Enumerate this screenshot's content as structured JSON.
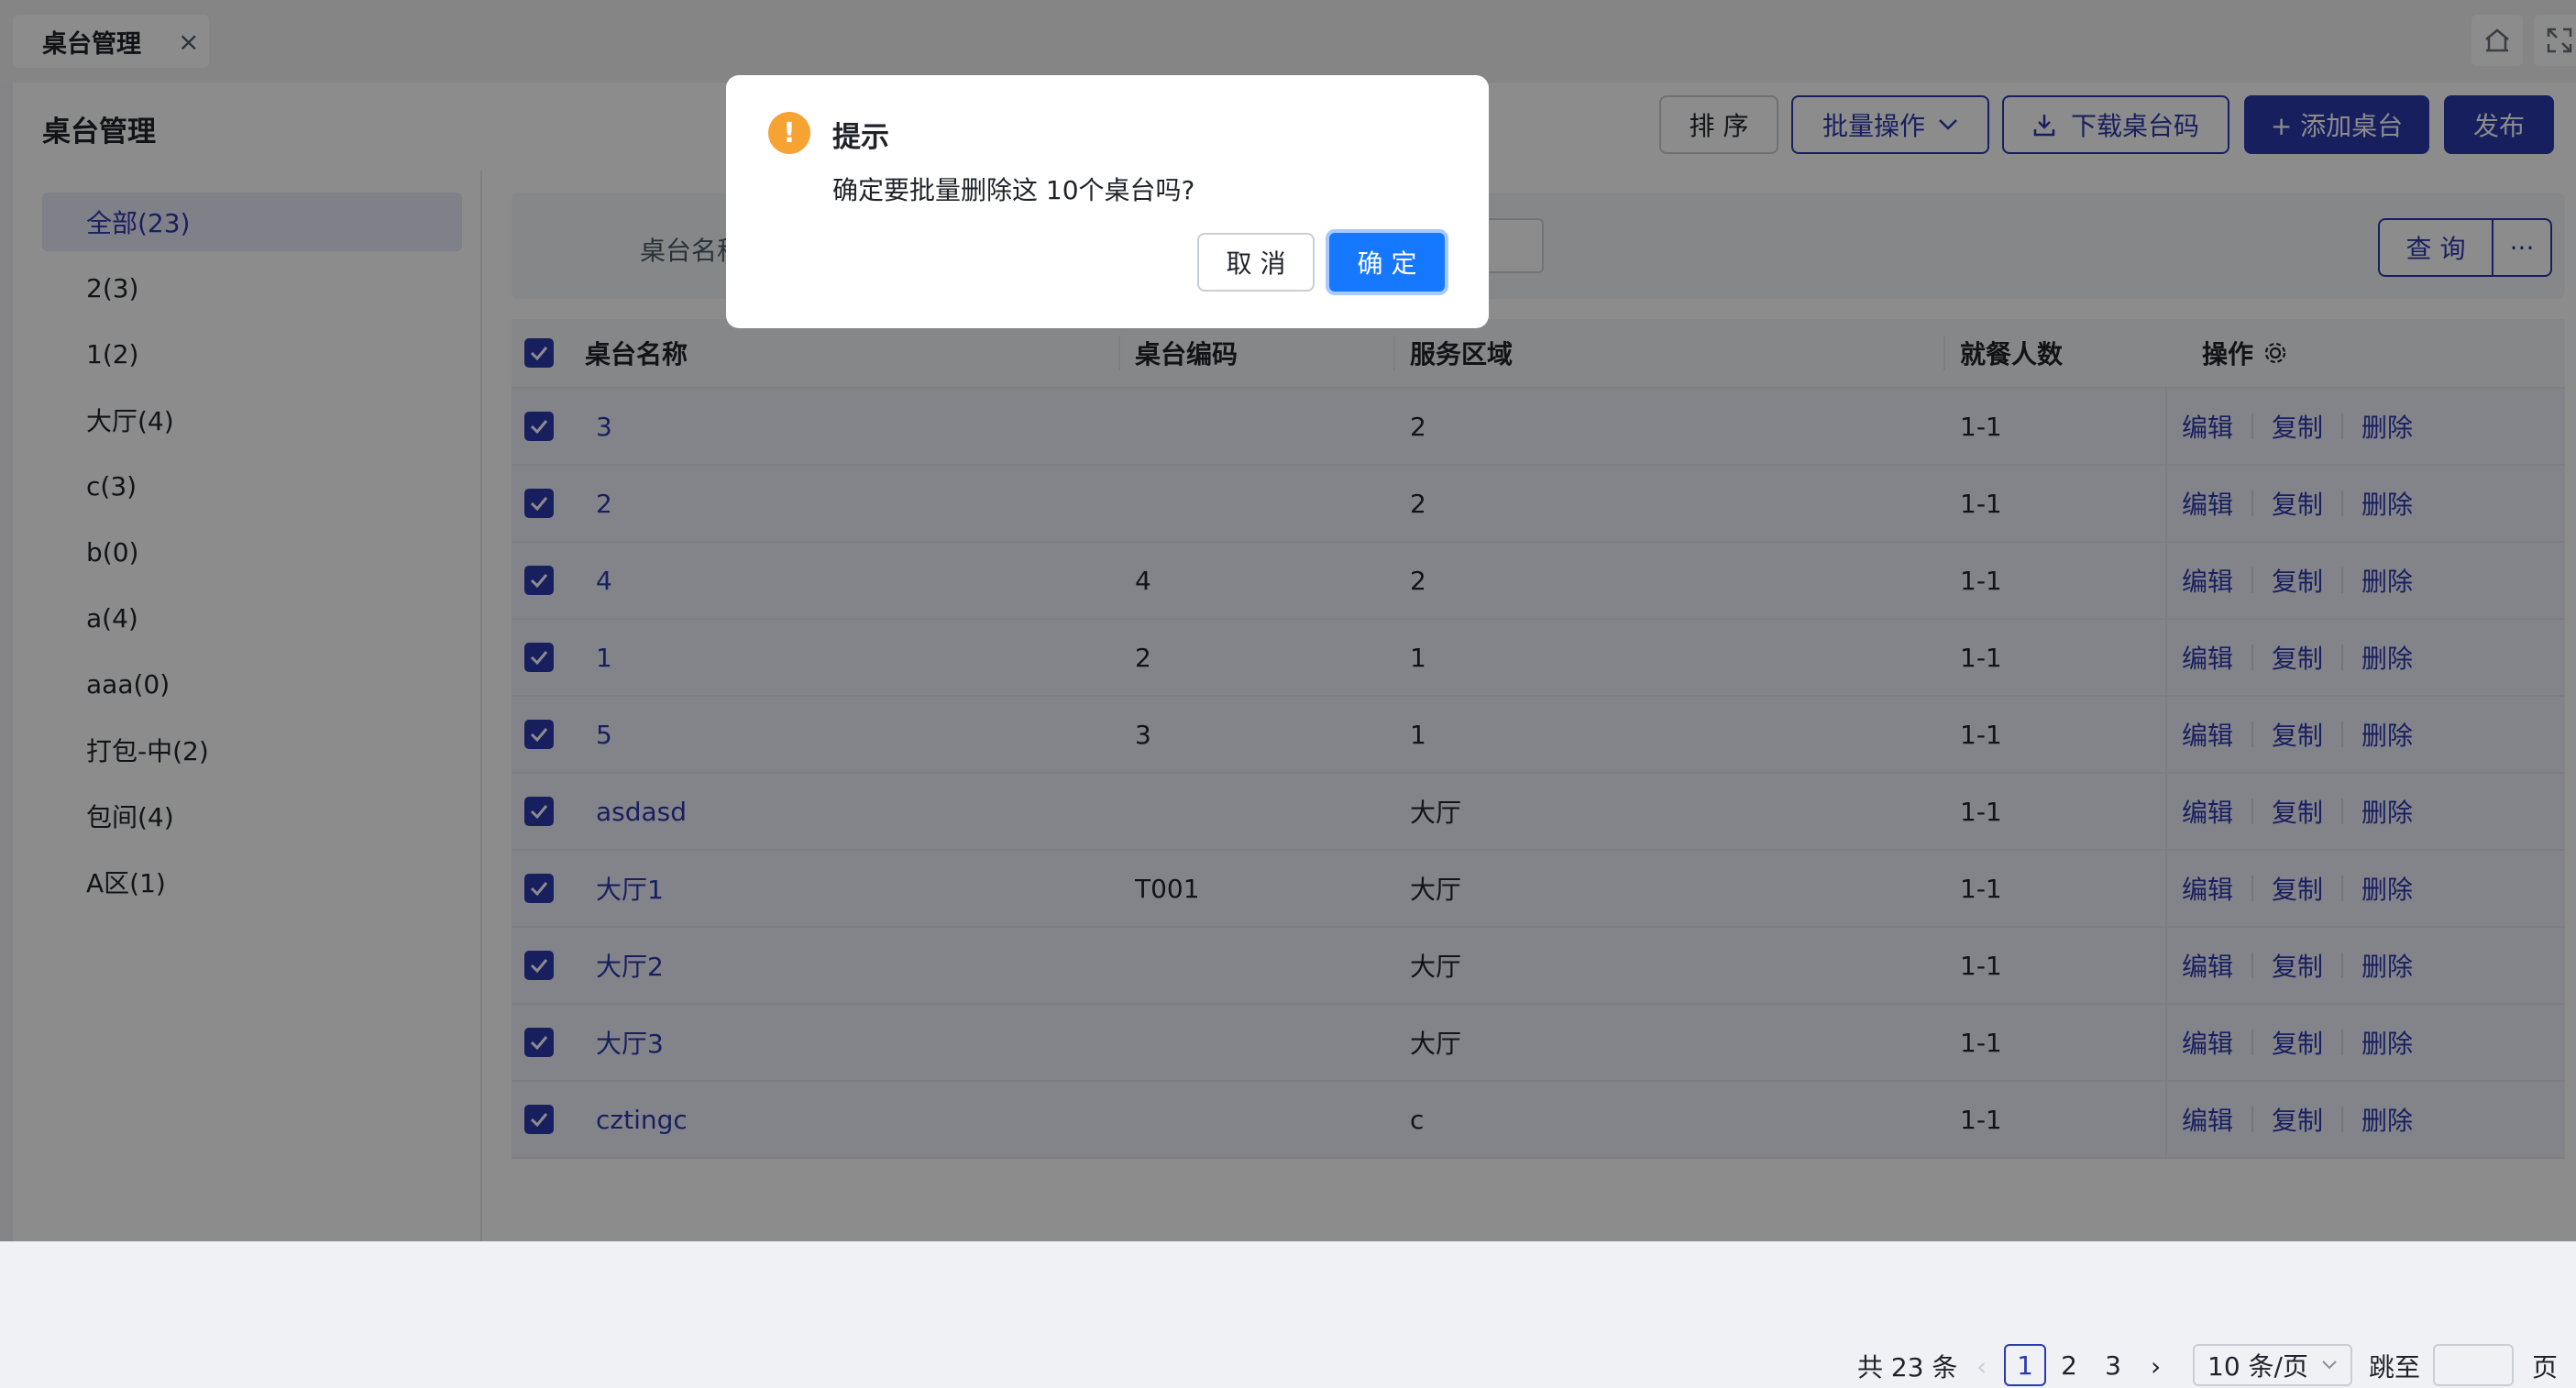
{
  "tabbar": {
    "tab_label": "桌台管理",
    "close_glyph": "×"
  },
  "header": {
    "title": "桌台管理",
    "sort_label": "排 序",
    "batch_label": "批量操作",
    "download_label": "下载桌台码",
    "add_label": "+ 添加桌台",
    "publish_label": "发布"
  },
  "sidebar": {
    "items": [
      {
        "label": "全部(23)",
        "active": true
      },
      {
        "label": "2(3)"
      },
      {
        "label": "1(2)"
      },
      {
        "label": "大厅(4)"
      },
      {
        "label": "c(3)"
      },
      {
        "label": "b(0)"
      },
      {
        "label": "a(4)"
      },
      {
        "label": "aaa(0)"
      },
      {
        "label": "打包-中(2)"
      },
      {
        "label": "包间(4)"
      },
      {
        "label": "A区(1)"
      }
    ]
  },
  "filter": {
    "label": "桌台名称",
    "query_label": "查 询",
    "more_label": "···"
  },
  "table": {
    "headers": {
      "name": "桌台名称",
      "code": "桌台编码",
      "area": "服务区域",
      "diners": "就餐人数",
      "ops": "操作"
    },
    "op_labels": {
      "edit": "编辑",
      "copy": "复制",
      "delete": "删除"
    },
    "rows": [
      {
        "name": "3",
        "code": "",
        "area": "2",
        "diners": "1-1"
      },
      {
        "name": "2",
        "code": "",
        "area": "2",
        "diners": "1-1"
      },
      {
        "name": "4",
        "code": "4",
        "area": "2",
        "diners": "1-1"
      },
      {
        "name": "1",
        "code": "2",
        "area": "1",
        "diners": "1-1"
      },
      {
        "name": "5",
        "code": "3",
        "area": "1",
        "diners": "1-1"
      },
      {
        "name": "asdasd",
        "code": "",
        "area": "大厅",
        "diners": "1-1"
      },
      {
        "name": "大厅1",
        "code": "T001",
        "area": "大厅",
        "diners": "1-1"
      },
      {
        "name": "大厅2",
        "code": "",
        "area": "大厅",
        "diners": "1-1"
      },
      {
        "name": "大厅3",
        "code": "",
        "area": "大厅",
        "diners": "1-1"
      },
      {
        "name": "cztingc",
        "code": "",
        "area": "c",
        "diners": "1-1"
      }
    ]
  },
  "pagination": {
    "total_label": "共 23 条",
    "pages": [
      "1",
      "2",
      "3"
    ],
    "current_page": "1",
    "page_size_label": "10 条/页",
    "jump_label": "跳至",
    "page_suffix": "页"
  },
  "dialog": {
    "icon_glyph": "!",
    "title": "提示",
    "message": "确定要批量删除这 10个桌台吗?",
    "cancel_label": "取 消",
    "ok_label": "确 定"
  },
  "colors": {
    "primary": "#2d3aae",
    "warning": "#f7a334",
    "confirm": "#1677ff"
  }
}
